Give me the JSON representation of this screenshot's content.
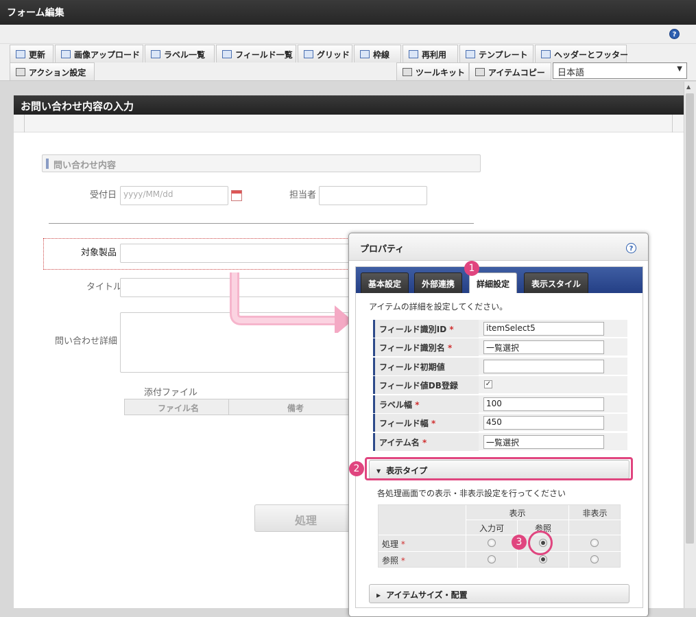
{
  "window": {
    "title": "フォーム編集"
  },
  "help_icon_glyph": "?",
  "toolbar": {
    "row1": [
      {
        "label": "更新",
        "icon": "refresh-icon"
      },
      {
        "label": "画像アップロード",
        "icon": "image-upload-icon"
      },
      {
        "label": "ラベル一覧",
        "icon": "label-list-icon"
      },
      {
        "label": "フィールド一覧",
        "icon": "field-list-icon"
      },
      {
        "label": "グリッド",
        "icon": "grid-icon"
      },
      {
        "label": "枠線",
        "icon": "border-icon"
      },
      {
        "label": "再利用",
        "icon": "reuse-icon"
      },
      {
        "label": "テンプレート",
        "icon": "template-icon"
      },
      {
        "label": "ヘッダーとフッター",
        "icon": "header-footer-icon"
      }
    ],
    "row2_left": [
      {
        "label": "アクション設定",
        "icon": "action-icon"
      }
    ],
    "row2_right": [
      {
        "label": "ツールキット",
        "icon": "toolkit-icon"
      },
      {
        "label": "アイテムコピー",
        "icon": "item-copy-icon"
      }
    ],
    "language": "日本語"
  },
  "form": {
    "header": "お問い合わせ内容の入力",
    "section": "問い合わせ内容",
    "receipt_date_label": "受付日",
    "receipt_date_placeholder": "yyyy/MM/dd",
    "staff_label": "担当者",
    "product_label": "対象製品",
    "title_label": "タイトル",
    "detail_label": "問い合わせ詳細",
    "attachment_label": "添付ファイル",
    "attachment_columns": [
      "ファイル名",
      "備考"
    ],
    "process_button": "処理"
  },
  "panel": {
    "title": "プロパティ",
    "tabs": [
      "基本設定",
      "外部連携",
      "詳細設定",
      "表示スタイル"
    ],
    "active_tab": "詳細設定",
    "description": "アイテムの詳細を設定してください。",
    "rows": [
      {
        "label": "フィールド識別ID",
        "required": true,
        "value": "itemSelect5"
      },
      {
        "label": "フィールド識別名",
        "required": true,
        "value": "一覧選択"
      },
      {
        "label": "フィールド初期値",
        "required": false,
        "value": ""
      },
      {
        "label": "フィールド値DB登録",
        "required": false,
        "checkbox": true,
        "checked": true
      },
      {
        "label": "ラベル幅",
        "required": true,
        "value": "100"
      },
      {
        "label": "フィールド幅",
        "required": true,
        "value": "450"
      },
      {
        "label": "アイテム名",
        "required": true,
        "value": "一覧選択"
      }
    ],
    "required_mark": "*",
    "display_type": {
      "title": "表示タイプ",
      "description": "各処理画面での表示・非表示設定を行ってください",
      "col_show": "表示",
      "col_input": "入力可",
      "col_ref": "参照",
      "col_hide": "非表示",
      "rows": [
        {
          "label": "処理",
          "selected": "ref"
        },
        {
          "label": "参照",
          "selected": "ref"
        }
      ]
    },
    "item_size": {
      "title": "アイテムサイズ・配置"
    }
  },
  "annotations": [
    "1",
    "2",
    "3"
  ],
  "colors": {
    "accent": "#e0457f",
    "tab_bar": "#2d4a8a",
    "title_bar": "#2a2a2a"
  }
}
